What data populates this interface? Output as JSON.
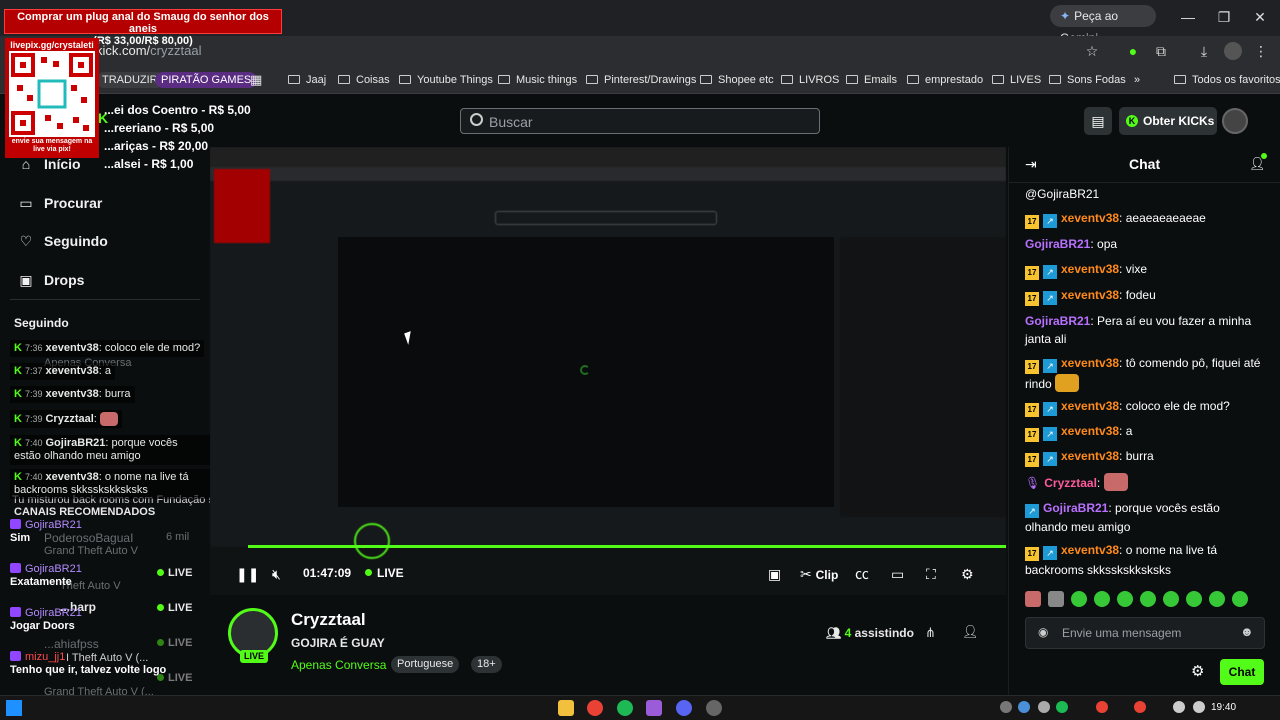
{
  "browser": {
    "url_host": "kick.com/",
    "url_path": "cryzztaal",
    "gemini_label": "Peça ao Gemini",
    "bookmarks": [
      {
        "label": "TRADUZIR",
        "type": "pill"
      },
      {
        "label": "PIRATÃO GAMES",
        "type": "pill"
      },
      {
        "label": "Jaaj"
      },
      {
        "label": "Coisas"
      },
      {
        "label": "Youtube Things"
      },
      {
        "label": "Music things"
      },
      {
        "label": "Pinterest/Drawings"
      },
      {
        "label": "Shopee etc"
      },
      {
        "label": "LIVROS"
      },
      {
        "label": "Emails"
      },
      {
        "label": "emprestado"
      },
      {
        "label": "LIVES"
      },
      {
        "label": "Sons Fodas"
      },
      {
        "label": "Todos os favoritos"
      }
    ]
  },
  "overlay": {
    "ad_line1": "Comprar um plug anal do Smaug do senhor dos aneis",
    "ad_line2": "(R$ 33,00/R$ 80,00)",
    "qr_top": "livepix.gg/crystaleti",
    "qr_bottom": "envie sua mensagem na live via pix!",
    "donations": [
      "...ei dos Coentro - R$ 5,00",
      "...reeriano - R$ 5,00",
      "...ariças - R$ 20,00",
      "...alsei - R$ 1,00"
    ]
  },
  "header": {
    "search_placeholder": "Buscar",
    "kicks_label": "Obter KICKs"
  },
  "sidebar": {
    "nav": [
      {
        "label": "Início",
        "icon": "home-icon"
      },
      {
        "label": "Procurar",
        "icon": "browse-icon"
      },
      {
        "label": "Seguindo",
        "icon": "heart-icon"
      },
      {
        "label": "Drops",
        "icon": "drops-icon"
      }
    ],
    "following_heading": "Seguindo",
    "recommended_heading": "CANAIS RECOMENDADOS",
    "ghost_texts": {
      "apenas": "Apenas Conversa",
      "backrooms": "Tu misturou back rooms com Fundação scp",
      "poderoso": "PoderosoBaguaI",
      "six_mil": "6 mil",
      "gta1": "Grand Theft Auto V",
      "gta2": "Theft Auto V",
      "sharp": "...harp",
      "fps": "...ahiafpss",
      "gta3": "I Theft Auto V (...",
      "gta4": "Grand Theft Auto V (..."
    },
    "live_label": "LIVE"
  },
  "overlay_chat": [
    {
      "time": "7:36",
      "user": "xeventv38",
      "text": "coloco ele de mod?"
    },
    {
      "time": "7:37",
      "user": "xeventv38",
      "text": "a"
    },
    {
      "time": "7:39",
      "user": "xeventv38",
      "text": "burra"
    },
    {
      "time": "7:39",
      "user": "Cryzztaal",
      "text": ""
    },
    {
      "time": "7:40",
      "user": "GojiraBR21",
      "text": "porque vocês estão olhando meu amigo"
    },
    {
      "time": "7:40",
      "user": "xeventv38",
      "text": "o nome na live tá backrooms skksskskksksks"
    }
  ],
  "twitch_chat": [
    {
      "user": "GojiraBR21",
      "text": "Sim"
    },
    {
      "user": "GojiraBR21",
      "text": "Exatamente"
    },
    {
      "user": "GojiraBR21",
      "text": "Jogar Doors"
    },
    {
      "user": "mizu_jj1",
      "text": "Tenho que ir, talvez volte logo"
    }
  ],
  "player": {
    "timecode": "01:47:09",
    "live_label": "LIVE",
    "clip_label": "Clip"
  },
  "stream": {
    "avatar_live": "LIVE",
    "name": "Cryzztaal",
    "title": "GOJIRA É GUAY",
    "category": "Apenas Conversa",
    "tags": [
      "Portuguese",
      "18+"
    ],
    "viewers_count": "4",
    "viewers_label": "assistindo"
  },
  "chat": {
    "title": "Chat",
    "first_line": "@GojiraBR21",
    "messages": [
      {
        "badges": [
          "17",
          "A"
        ],
        "user": "xeventv38",
        "color": "orange",
        "text": "aeaeaeaeaeae"
      },
      {
        "badges": [],
        "user": "GojiraBR21",
        "color": "purple",
        "text": "opa"
      },
      {
        "badges": [
          "17",
          "A"
        ],
        "user": "xeventv38",
        "color": "orange",
        "text": "vixe"
      },
      {
        "badges": [
          "17",
          "A"
        ],
        "user": "xeventv38",
        "color": "orange",
        "text": "fodeu"
      },
      {
        "badges": [],
        "user": "GojiraBR21",
        "color": "purple",
        "text": "Pera aí eu vou fazer a minha janta ali"
      },
      {
        "badges": [
          "17",
          "A"
        ],
        "user": "xeventv38",
        "color": "orange",
        "text": "tô comendo pô, fiquei até rindo"
      },
      {
        "badges": [
          "17",
          "A"
        ],
        "user": "xeventv38",
        "color": "orange",
        "text": "coloco ele de mod?"
      },
      {
        "badges": [
          "17",
          "A"
        ],
        "user": "xeventv38",
        "color": "orange",
        "text": "a"
      },
      {
        "badges": [
          "17",
          "A"
        ],
        "user": "xeventv38",
        "color": "orange",
        "text": "burra"
      },
      {
        "badges": [
          "mic"
        ],
        "user": "Cryzztaal",
        "color": "pink",
        "text": ""
      },
      {
        "badges": [
          "A"
        ],
        "user": "GojiraBR21",
        "color": "purple",
        "text": "porque vocês estão olhando meu amigo"
      },
      {
        "badges": [
          "17",
          "A"
        ],
        "user": "xeventv38",
        "color": "orange",
        "text": "o nome na live tá backrooms skksskskksksks"
      }
    ],
    "input_placeholder": "Envie uma mensagem",
    "send_label": "Chat"
  },
  "taskbar": {
    "clock": "19:40"
  },
  "colors": {
    "kick_green": "#53fc18",
    "background": "#0b0e0f",
    "ad_red": "#b40000"
  }
}
